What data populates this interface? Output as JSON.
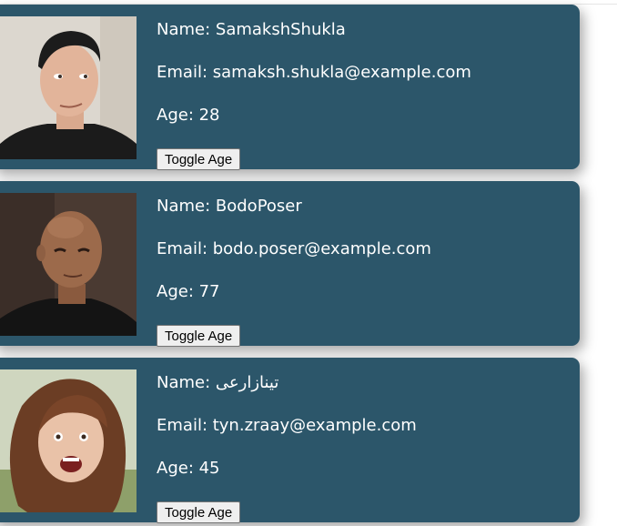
{
  "users": [
    {
      "name_label": "Name: SamakshShukla",
      "email_label": "Email: samaksh.shukla@example.com",
      "age_label": "Age: 28",
      "button": "Toggle Age"
    },
    {
      "name_label": "Name: BodoPoser",
      "email_label": "Email: bodo.poser@example.com",
      "age_label": "Age: 77",
      "button": "Toggle Age"
    },
    {
      "name_label": "Name: تینازارعی",
      "email_label": "Email: tyn.zraay@example.com",
      "age_label": "Age: 45",
      "button": "Toggle Age"
    }
  ],
  "colors": {
    "card_bg": "#2c566a",
    "text": "#ffffff"
  }
}
